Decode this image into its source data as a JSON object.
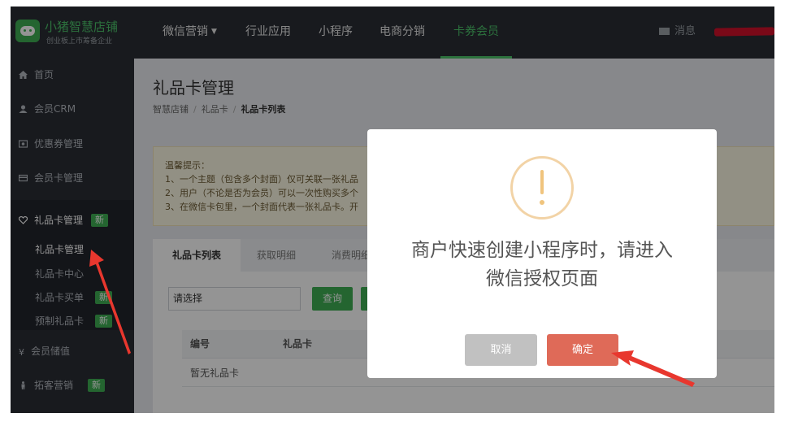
{
  "logo": {
    "name": "小猪智慧店铺",
    "slogan": "创业板上市筹备企业"
  },
  "topnav": {
    "items": [
      {
        "label": "微信营销",
        "caret": "▼"
      },
      {
        "label": "行业应用"
      },
      {
        "label": "小程序"
      },
      {
        "label": "电商分销"
      },
      {
        "label": "卡券会员"
      }
    ],
    "active_index": 4,
    "message_label": "消息"
  },
  "sidebar": {
    "items": [
      {
        "label": "首页",
        "icon": "home-icon"
      },
      {
        "label": "会员CRM",
        "icon": "user-icon"
      },
      {
        "label": "优惠券管理",
        "icon": "ticket-icon"
      },
      {
        "label": "会员卡管理",
        "icon": "card-icon"
      }
    ],
    "group": {
      "label": "礼品卡管理",
      "icon": "heart-icon",
      "badge": "新",
      "children": [
        {
          "label": "礼品卡管理",
          "active": true
        },
        {
          "label": "礼品卡中心"
        },
        {
          "label": "礼品卡买单",
          "badge": "新"
        },
        {
          "label": "预制礼品卡",
          "badge": "新"
        }
      ]
    },
    "bottom_items": [
      {
        "label": "会员储值",
        "icon": "yen-icon"
      },
      {
        "label": "拓客营销",
        "icon": "person-icon",
        "badge": "新"
      }
    ]
  },
  "page": {
    "title": "礼品卡管理",
    "breadcrumb": [
      "智慧店铺",
      "礼品卡",
      "礼品卡列表"
    ],
    "tips": {
      "title": "温馨提示：",
      "lines": [
        "1、一个主题（包含多个封面）仅可关联一张礼品",
        "2、用户（不论是否为会员）可以一次性购买多个",
        "3、在微信卡包里，一个封面代表一张礼品卡。开"
      ]
    },
    "tabs": [
      "礼品卡列表",
      "获取明细",
      "消费明细"
    ],
    "active_tab": 0,
    "filter": {
      "select_placeholder": "请选择",
      "query_label": "查询"
    },
    "table": {
      "headers": [
        "编号",
        "礼品卡"
      ],
      "empty_text": "暂无礼品卡"
    }
  },
  "dialog": {
    "icon": "warning-icon",
    "message_line1": "商户快速创建小程序时，请进入",
    "message_line2": "微信授权页面",
    "cancel_label": "取消",
    "confirm_label": "确定"
  },
  "colors": {
    "nav_bg": "#2a2d35",
    "accent_green": "#3fae54",
    "confirm_red": "#df6a58",
    "warning": "#f0c47d",
    "annotation_arrow": "#e8372e"
  }
}
